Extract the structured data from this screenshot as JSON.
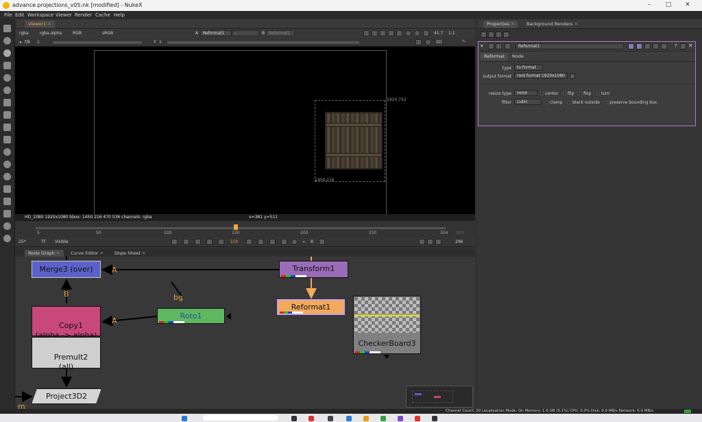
{
  "window": {
    "title": "advance projections_v05.nk [modified] - NukeX"
  },
  "menubar": [
    "File",
    "Edit",
    "Workspace",
    "Viewer",
    "Render",
    "Cache",
    "Help"
  ],
  "viewer": {
    "tab": "Viewer1",
    "channels": "rgba",
    "alpha": "rgba.alpha",
    "colorspace": "RGB",
    "lut": "sRGB",
    "input_a_label": "A",
    "input_a": "Reformat1",
    "input_a_op": "-",
    "input_b_label": "B",
    "input_b": "Reformat1",
    "frame_range": "f/8",
    "frame_step": "1",
    "y_label": "Y",
    "y_value": "1",
    "zoom": "41.7",
    "proxy": "1:1",
    "view_mode": "2D",
    "coord_tr": "1920,752",
    "coord_bl": "1450,216",
    "info_left": "HD_1080 1920x1080  bbox: 1450 216 470 536 channels: rgba",
    "info_right": "x=381 y=511",
    "timeline_ticks": [
      "5",
      "50",
      "100",
      "150",
      "200",
      "250",
      "304",
      "300"
    ],
    "current_frame": "150",
    "fps": "25*",
    "tf": "TF",
    "visible": "Visible",
    "step": "8",
    "end_frame": "296"
  },
  "panels": {
    "node_graph_tab": "Node Graph",
    "curve_editor_tab": "Curve Editor",
    "dope_sheet_tab": "Dope Sheet"
  },
  "nodes": {
    "merge": "Merge3 (over)",
    "transform": "Transform1",
    "reformat": "Reformat1",
    "roto": "Roto1",
    "copy": "Copy1\n(alpha -> alpha)",
    "premult": "Premult2\n(all)",
    "checker": "CheckerBoard3",
    "project": "Project3D2",
    "labels": {
      "a1": "A",
      "b": "B",
      "bg": "bg",
      "a2": "A",
      "m": "m"
    }
  },
  "properties": {
    "tab_properties": "Properties",
    "tab_bg_renders": "Background Renders",
    "node_name": "Reformat1",
    "subtab_reformat": "Reformat",
    "subtab_node": "Node",
    "type_label": "type",
    "type_value": "to format",
    "output_format_label": "output format",
    "output_format_value": "root.format 1920x1080",
    "resize_type_label": "resize type",
    "resize_type_value": "none",
    "center": "center",
    "flip": "flip",
    "flop": "flop",
    "turn": "turn",
    "filter_label": "filter",
    "filter_value": "cubic",
    "clamp": "clamp",
    "black_outside": "black outside",
    "preserve_bbox": "preserve bounding box"
  },
  "statusbar": {
    "text": "Channel Count: 20  Localization Mode: On  Memory: 1.6 GB (5.1%)  CPU: 0.0%  Disk: 0.0 MB/s  Network: 0.0 MB/s"
  },
  "colors": {
    "merge": "#5a62c9",
    "transform": "#9a6cb8",
    "reformat": "#f2a95c",
    "roto": "#5fb85f",
    "copy": "#c9487a",
    "premult": "#cfcfcf",
    "project": "#d5d5d5"
  }
}
